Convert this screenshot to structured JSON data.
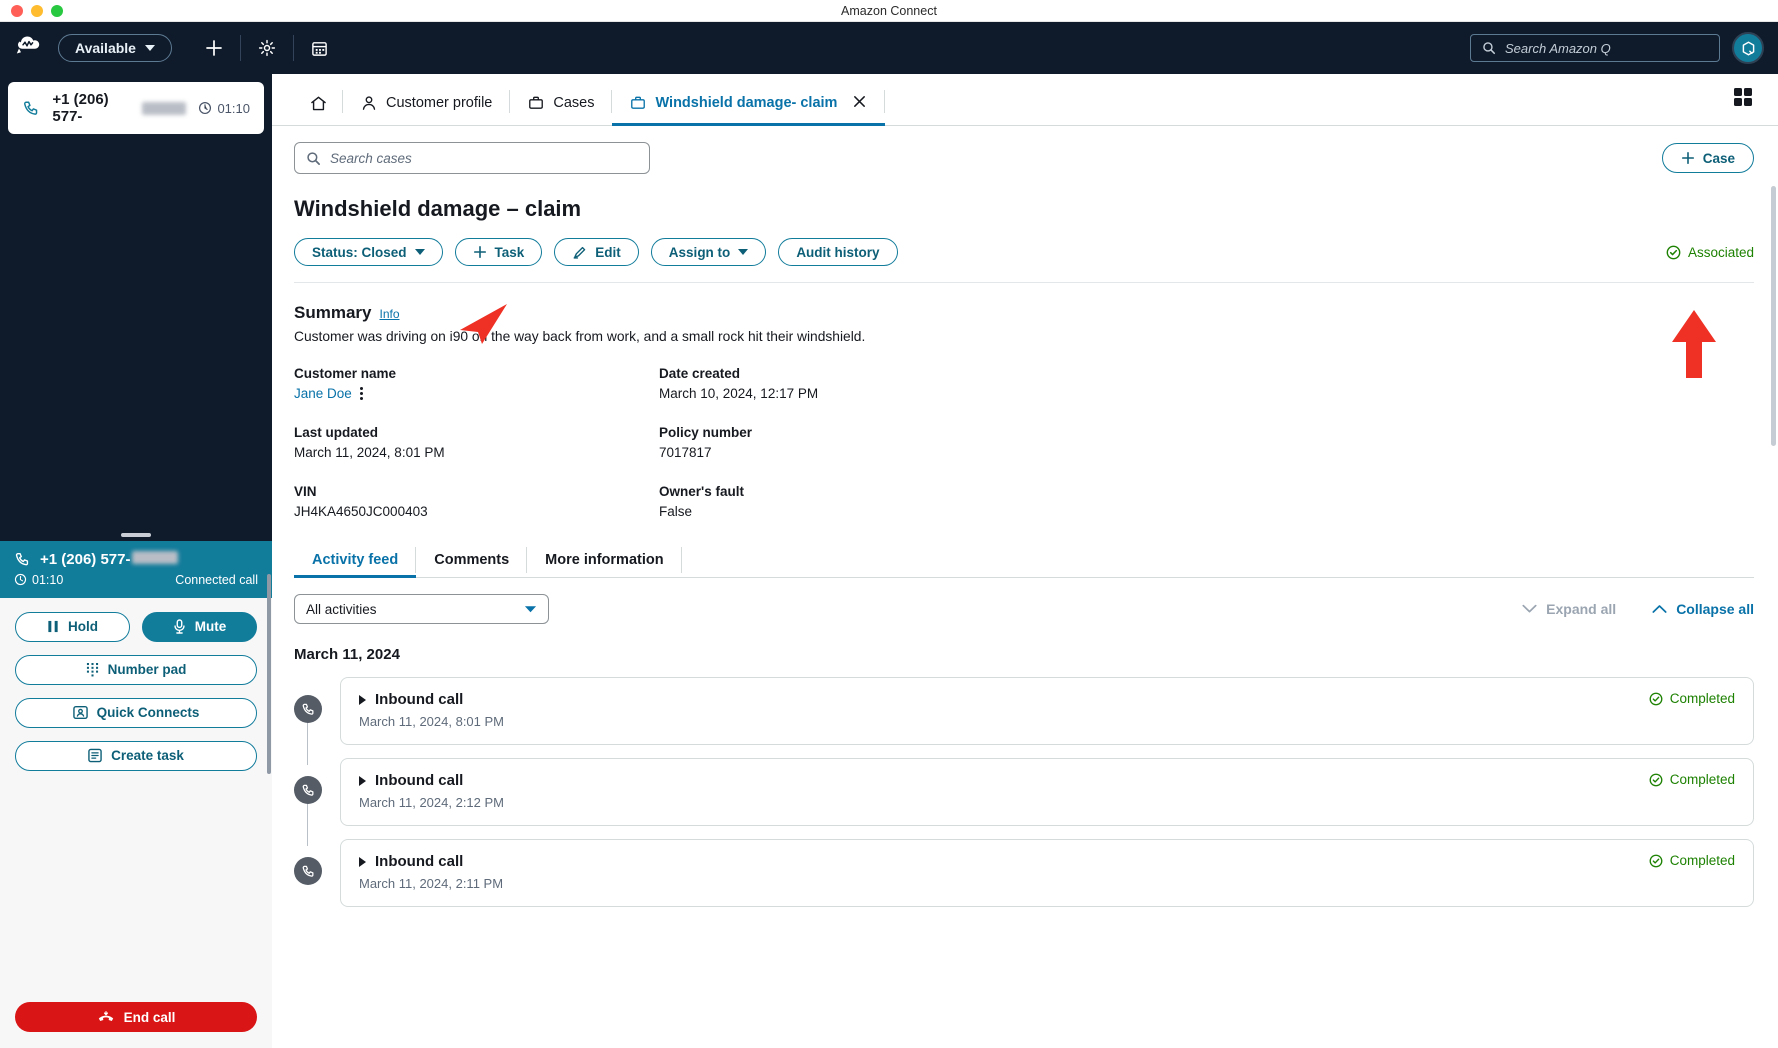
{
  "window": {
    "title": "Amazon Connect"
  },
  "topnav": {
    "logo_icon": "amazon-connect-cloud-logo",
    "status": {
      "label": "Available",
      "caret_icon": "caret-down-icon"
    },
    "add_icon": "plus-icon",
    "settings_icon": "gear-icon",
    "calendar_icon": "calendar-icon",
    "search": {
      "placeholder": "Search Amazon Q",
      "icon": "search-icon"
    },
    "avatar": {
      "icon": "amazon-q-icon"
    }
  },
  "ccp": {
    "contact": {
      "phone_icon": "phone-icon",
      "number": "+1 (206) 577-",
      "clock_icon": "clock-icon",
      "duration": "01:10"
    },
    "call": {
      "phone_icon": "phone-icon",
      "number": "+1 (206) 577-",
      "clock_icon": "clock-icon",
      "duration": "01:10",
      "state": "Connected call"
    },
    "buttons": {
      "hold": {
        "label": "Hold",
        "icon": "pause-icon"
      },
      "mute": {
        "label": "Mute",
        "icon": "microphone-icon"
      },
      "number_pad": {
        "label": "Number pad",
        "icon": "dialpad-icon"
      },
      "quick_connects": {
        "label": "Quick Connects",
        "icon": "contact-card-icon"
      },
      "create_task": {
        "label": "Create task",
        "icon": "task-icon"
      },
      "end_call": {
        "label": "End call",
        "icon": "end-call-icon"
      }
    }
  },
  "tabs": [
    {
      "label": "",
      "icon": "home-icon",
      "active": false
    },
    {
      "label": "Customer profile",
      "icon": "person-icon",
      "active": false
    },
    {
      "label": "Cases",
      "icon": "briefcase-icon",
      "active": false
    },
    {
      "label": "Windshield damage- claim",
      "icon": "briefcase-icon",
      "active": true,
      "close_icon": "close-icon"
    }
  ],
  "apps_grid_icon": "grid-icon",
  "search_cases": {
    "placeholder": "Search cases",
    "icon": "search-icon"
  },
  "case_button": {
    "label": "Case",
    "icon": "plus-icon"
  },
  "case": {
    "title": "Windshield damage – claim",
    "actions": [
      {
        "label": "Status: Closed",
        "icon": "caret-down-icon",
        "name": "status-button"
      },
      {
        "label": "Task",
        "icon": "plus-icon",
        "name": "task-button"
      },
      {
        "label": "Edit",
        "icon": "pencil-icon",
        "name": "edit-button"
      },
      {
        "label": "Assign to",
        "icon": "caret-down-icon",
        "name": "assign-to-button"
      },
      {
        "label": "Audit history",
        "icon": "",
        "name": "audit-history-button"
      }
    ],
    "association": {
      "label": "Associated",
      "icon": "check-circle-icon",
      "color": "#1d8102"
    },
    "summary": {
      "heading": "Summary",
      "info_link": "Info",
      "text": "Customer was driving on i90 on the way back from work, and a small rock hit their windshield."
    },
    "fields": [
      [
        {
          "label": "Customer name",
          "value": "Jane Doe",
          "is_link": true,
          "has_menu": true
        },
        {
          "label": "Date created",
          "value": "March 10, 2024, 12:17 PM",
          "is_link": false,
          "has_menu": false
        }
      ],
      [
        {
          "label": "Last updated",
          "value": "March 11, 2024, 8:01 PM",
          "is_link": false,
          "has_menu": false
        },
        {
          "label": "Policy number",
          "value": "7017817",
          "is_link": false,
          "has_menu": false
        }
      ],
      [
        {
          "label": "VIN",
          "value": "JH4KA4650JC000403",
          "is_link": false,
          "has_menu": false
        },
        {
          "label": "Owner's fault",
          "value": "False",
          "is_link": false,
          "has_menu": false
        }
      ]
    ]
  },
  "feed": {
    "tabs": [
      {
        "label": "Activity feed",
        "active": true
      },
      {
        "label": "Comments",
        "active": false
      },
      {
        "label": "More information",
        "active": false
      }
    ],
    "filter": {
      "value": "All activities",
      "caret_icon": "caret-down-icon"
    },
    "expand_all": {
      "label": "Expand all",
      "icon": "chevron-down-icon",
      "enabled": false
    },
    "collapse_all": {
      "label": "Collapse all",
      "icon": "chevron-up-icon",
      "enabled": true
    },
    "date_group": "March 11, 2024",
    "items": [
      {
        "icon": "phone-icon",
        "title": "Inbound call",
        "timestamp": "March 11, 2024, 8:01 PM",
        "status": "Completed",
        "status_icon": "check-circle-icon"
      },
      {
        "icon": "phone-icon",
        "title": "Inbound call",
        "timestamp": "March 11, 2024, 2:12 PM",
        "status": "Completed",
        "status_icon": "check-circle-icon"
      },
      {
        "icon": "phone-icon",
        "title": "Inbound call",
        "timestamp": "March 11, 2024, 2:11 PM",
        "status": "Completed",
        "status_icon": "check-circle-icon"
      }
    ]
  },
  "annotations": [
    {
      "name": "arrow-pointing-status-button",
      "color": "#ee3124"
    },
    {
      "name": "arrow-pointing-associated-badge",
      "color": "#ee3124"
    }
  ]
}
